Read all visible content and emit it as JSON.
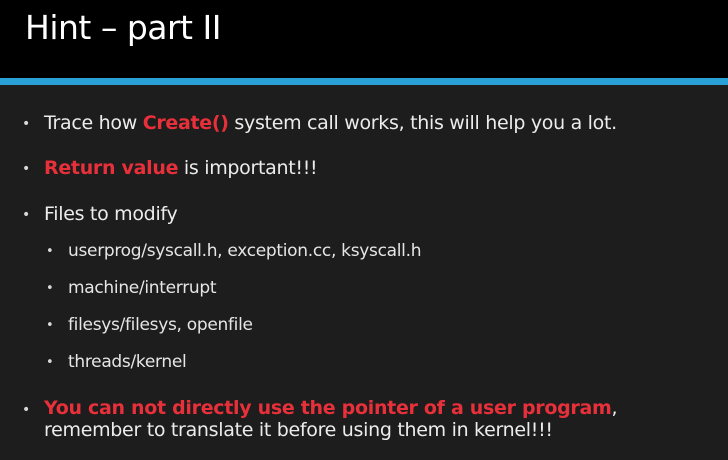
{
  "slide": {
    "title": "Hint – part II",
    "items": [
      {
        "bullet": "•",
        "pre": "Trace how ",
        "highlight": "Create()",
        "post": " system call works, this will help you a lot."
      },
      {
        "bullet": "•",
        "highlight": "Return value",
        "post": " is important!!!"
      },
      {
        "bullet": "•",
        "text": "Files to modify"
      }
    ],
    "subitems": [
      {
        "bullet": "•",
        "text": "userprog/syscall.h, exception.cc, ksyscall.h"
      },
      {
        "bullet": "•",
        "text": "machine/interrupt"
      },
      {
        "bullet": "•",
        "text": "filesys/filesys, openfile"
      },
      {
        "bullet": "•",
        "text": "threads/kernel"
      }
    ],
    "last": {
      "bullet": "•",
      "highlight": "You can not directly use the pointer of a user program",
      "post": ", remember to translate it before using them in kernel!!!"
    }
  },
  "colors": {
    "accent_bar": "#2aa1d6",
    "highlight": "#e8303a",
    "title_background": "#000000",
    "body_background": "#1d1d1d"
  }
}
